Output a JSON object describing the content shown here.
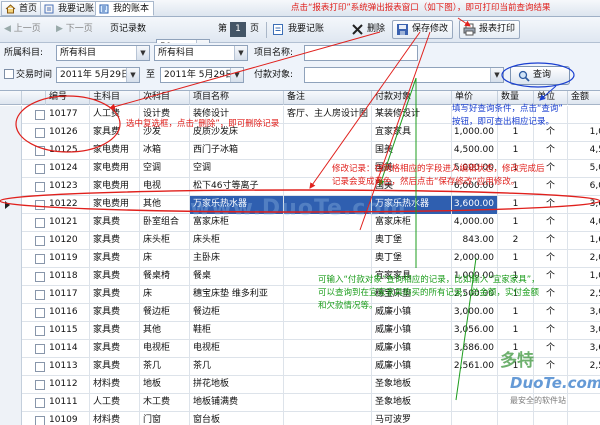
{
  "tabs": [
    {
      "label": "首页",
      "icon": "home-icon"
    },
    {
      "label": "我要记账",
      "icon": "ledger-icon"
    },
    {
      "label": "我的账本",
      "icon": "account-book-icon"
    }
  ],
  "toolbar": {
    "prev_page": "上一页",
    "next_page": "下一页",
    "records_label": "页记录数",
    "records_value": "50",
    "page_prefix": "第",
    "page_value": "1",
    "page_suffix": "页",
    "ledger_btn": "我要记账",
    "delete_btn": "删除",
    "save_btn": "保存修改",
    "print_btn": "报表打印"
  },
  "filters": {
    "category_label": "所属科目:",
    "category_value": "所有科目",
    "subcategory_value": "所有科目",
    "item_label": "项目名称:",
    "item_value": "",
    "time_label": "交易时间",
    "date_from": "2011年 5月29日",
    "date_sep": "至",
    "date_to": "2011年 5月29日",
    "payee_label": "付款对象:",
    "payee_value": "",
    "query_btn": "查询"
  },
  "grid": {
    "columns": [
      "编号",
      "主科目",
      "次科目",
      "项目名称",
      "备注",
      "付款对象",
      "单价",
      "数量",
      "单位",
      "金额"
    ],
    "rows": [
      [
        "10177",
        "人工费",
        "设计费",
        "装修设计",
        "客厅、主人房设计图",
        "某装修设计",
        "",
        "",
        "",
        ""
      ],
      [
        "10126",
        "家具费",
        "沙发",
        "皮质沙发床",
        "",
        "宜家家具",
        "1,000.00",
        "1",
        "个",
        "1,0"
      ],
      [
        "10125",
        "家电费用",
        "冰箱",
        "西门子冰箱",
        "",
        "国美",
        "4,500.00",
        "1",
        "个",
        "4,5"
      ],
      [
        "10124",
        "家电费用",
        "空调",
        "空调",
        "",
        "国美",
        "5,000.00",
        "1",
        "个",
        "5,0"
      ],
      [
        "10123",
        "家电费用",
        "电视",
        "松下46寸等离子",
        "",
        "国美",
        "6,000.00",
        "1",
        "个",
        "6,0"
      ],
      [
        "10122",
        "家电费用",
        "其他",
        "万家乐热水器",
        "",
        "万家乐热水器",
        "3,600.00",
        "1",
        "个",
        "3,6"
      ],
      [
        "10121",
        "家具费",
        "卧室组合",
        "富家床柜",
        "",
        "富家床柜",
        "4,000.00",
        "1",
        "个",
        "4,0"
      ],
      [
        "10120",
        "家具费",
        "床头柜",
        "床头柜",
        "",
        "奥丁堡",
        "843.00",
        "2",
        "个",
        "1,6"
      ],
      [
        "10119",
        "家具费",
        "床",
        "主卧床",
        "",
        "奥丁堡",
        "2,000.00",
        "1",
        "个",
        "2,0"
      ],
      [
        "10118",
        "家具费",
        "餐桌椅",
        "餐桌",
        "",
        "宜家家具",
        "1,000.00",
        "1",
        "个",
        "1,0"
      ],
      [
        "10117",
        "家具费",
        "床",
        "穗宝床垫 维多利亚",
        "",
        "穗宝床垫",
        "2,500.00",
        "1",
        "个",
        "2,5"
      ],
      [
        "10116",
        "家具费",
        "餐边柜",
        "餐边柜",
        "",
        "威廉小镇",
        "3,000.00",
        "1",
        "个",
        "3,0"
      ],
      [
        "10115",
        "家具费",
        "其他",
        "鞋柜",
        "",
        "威廉小镇",
        "3,056.00",
        "1",
        "个",
        "3,0"
      ],
      [
        "10114",
        "家具费",
        "电视柜",
        "电视柜",
        "",
        "威廉小镇",
        "3,686.00",
        "1",
        "个",
        "3,6"
      ],
      [
        "10113",
        "家具费",
        "茶几",
        "茶几",
        "",
        "威廉小镇",
        "2,561.00",
        "1",
        "个",
        "2,5"
      ],
      [
        "10112",
        "材料费",
        "地板",
        "拼花地板",
        "",
        "圣象地板",
        "",
        "",
        "",
        ""
      ],
      [
        "10111",
        "人工费",
        "木工费",
        "地板铺满费",
        "",
        "圣象地板",
        "",
        "",
        "",
        ""
      ],
      [
        "10109",
        "材料费",
        "门窗",
        "窗台板",
        "",
        "马可波罗",
        "",
        "",
        "",
        ""
      ]
    ],
    "selected_index": 5
  },
  "annotations": {
    "print_note": "点击“报表打印”系统弹出报表窗口（如下图），即可打印当前查询结果",
    "delete_note": "选中复选框，点击“删除”，即可删除记录",
    "query_note_1": "填写好查询条件，点击“查询”",
    "query_note_2": "按钮，即可查出相应记录。",
    "edit_note_1": "修改记录：在网格相应的字段进入编辑状态，修改完成后",
    "edit_note_2": "记录会变成黄色，然后点击“保存修改”应用修改。",
    "payee_note_1": "可输入“付款对象”查询相应的记录，比如输入“宜家家具”，",
    "payee_note_2": "可以查询到在宜家家具购买的所有记录，总金额，实付金额",
    "payee_note_3": "和欠款情况等。",
    "watermark": "www.DuoTe.com"
  },
  "logo": {
    "line1": "多特",
    "line2": "DuoTe.com",
    "line3": "最安全的软件站"
  },
  "colors": {
    "annotation_red": "#e0201c",
    "annotation_blue": "#1a3fd0",
    "annotation_green": "#1d9d1d",
    "selection": "#2f5fb0"
  }
}
